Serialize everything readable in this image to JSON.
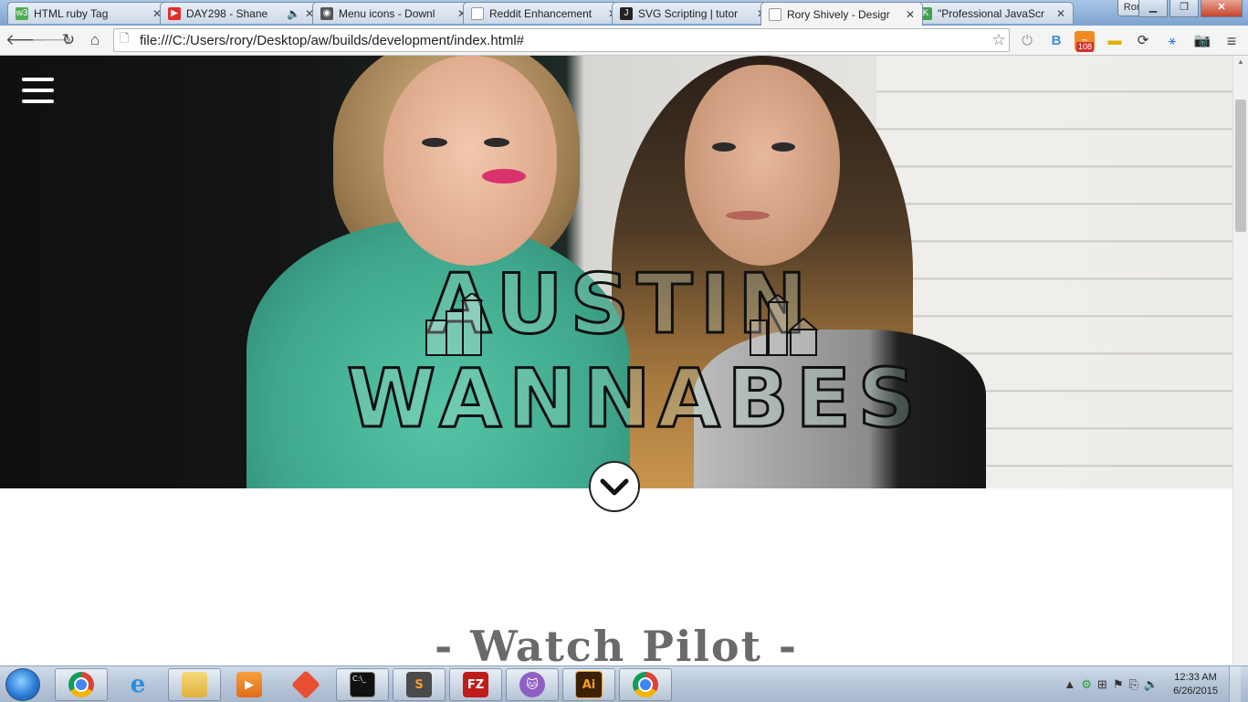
{
  "browser": {
    "tabs": [
      {
        "title": "HTML ruby Tag",
        "favicon": "w3-icon",
        "favicon_color": "#4caf50"
      },
      {
        "title": "DAY298 - Shane",
        "favicon": "youtube-icon",
        "favicon_color": "#e52d27"
      },
      {
        "title": "Menu icons - Downl",
        "favicon": "icons-site-icon",
        "favicon_color": "#333333"
      },
      {
        "title": "Reddit Enhancement",
        "favicon": "page-icon",
        "favicon_color": "#9e9e9e"
      },
      {
        "title": "SVG Scripting | tutor",
        "favicon": "j-icon",
        "favicon_color": "#222222"
      },
      {
        "title": "Rory Shively - Desigr",
        "favicon": "page-icon",
        "favicon_color": "#9e9e9e",
        "active": true
      },
      {
        "title": "\"Professional JavaScr",
        "favicon": "k-icon",
        "favicon_color": "#3fa34d"
      }
    ],
    "profile_name": "Rory",
    "url": "file:///C:/Users/rory/Desktop/aw/builds/development/index.html#",
    "rss_badge": "108"
  },
  "page": {
    "logo_line1": "AUSTIN",
    "logo_line2": "WANNABES",
    "section_title": "- Watch Pilot -"
  },
  "taskbar": {
    "apps": [
      "chrome-icon",
      "ie-icon",
      "explorer-icon",
      "media-player-icon",
      "git-icon",
      "cmd-icon",
      "sublime-icon",
      "filezilla-icon",
      "github-icon",
      "illustrator-icon",
      "chrome-icon"
    ],
    "cmd_label": "C:\\_",
    "sublime_label": "S",
    "filezilla_label": "FZ",
    "illustrator_label": "Ai",
    "time": "12:33 AM",
    "date": "6/26/2015"
  },
  "colors": {
    "accent_tab_active": "#f4f4f4",
    "shirt_teal": "#3fa88d",
    "hero_dark": "#101010"
  }
}
